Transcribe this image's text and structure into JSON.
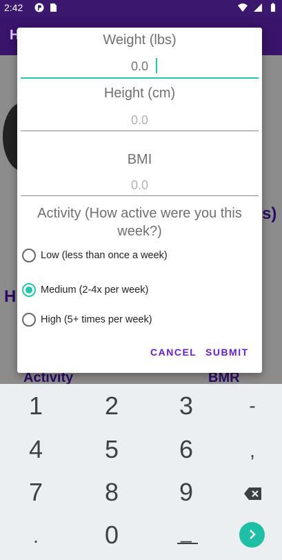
{
  "status_bar": {
    "time": "2:42"
  },
  "background": {
    "app_title": "H",
    "left_letter": "H",
    "right_fragment": "s)",
    "activity_label": "Activity",
    "bmr_label": "BMR"
  },
  "dialog": {
    "weight": {
      "label": "Weight (lbs)",
      "value": "0.0"
    },
    "height": {
      "label": "Height (cm)",
      "placeholder": "0.0"
    },
    "bmi": {
      "label": "BMI",
      "placeholder": "0.0"
    },
    "activity": {
      "question": "Activity (How active were you this week?)",
      "options": [
        {
          "label": "Low (less than once a week)",
          "selected": false
        },
        {
          "label": "Medium (2-4x per week)",
          "selected": true
        },
        {
          "label": "High (5+ times per week)",
          "selected": false
        }
      ]
    },
    "cancel_label": "CANCEL",
    "submit_label": "SUBMIT"
  },
  "keyboard": {
    "keys": [
      "1",
      "2",
      "3",
      "-",
      "4",
      "5",
      "6",
      ",",
      "7",
      "8",
      "9",
      ".",
      "0",
      "_"
    ]
  },
  "colors": {
    "accent": "#1fc7b0",
    "button_text": "#6a1bd6",
    "status_bar": "#3c176e"
  }
}
